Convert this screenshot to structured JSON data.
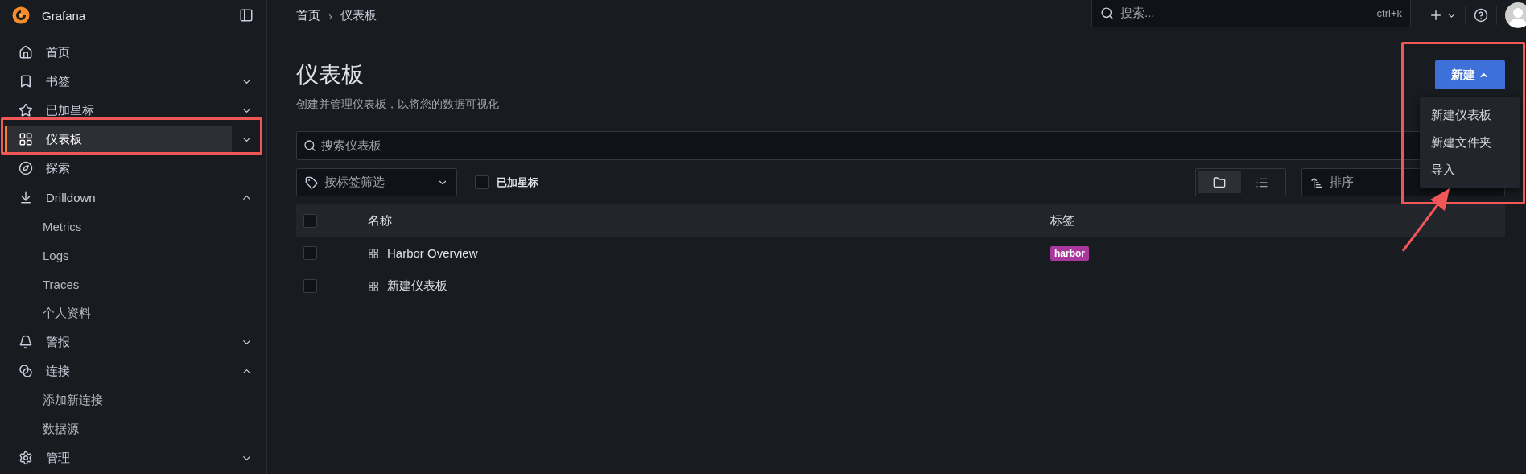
{
  "sidebar": {
    "brand": "Grafana",
    "items": [
      {
        "label": "首页",
        "kind": "link",
        "selected": false
      },
      {
        "label": "书签",
        "kind": "section",
        "selected": false,
        "expanded": false
      },
      {
        "label": "已加星标",
        "kind": "section",
        "selected": false,
        "expanded": false
      },
      {
        "label": "仪表板",
        "kind": "section",
        "selected": true,
        "expanded": false
      },
      {
        "label": "探索",
        "kind": "link",
        "selected": false
      },
      {
        "label": "Drilldown",
        "kind": "section",
        "selected": false,
        "expanded": true,
        "children": [
          {
            "label": "Metrics"
          },
          {
            "label": "Logs"
          },
          {
            "label": "Traces"
          },
          {
            "label": "个人资料"
          }
        ]
      },
      {
        "label": "警报",
        "kind": "section",
        "selected": false,
        "expanded": false
      },
      {
        "label": "连接",
        "kind": "section",
        "selected": false,
        "expanded": true,
        "children": [
          {
            "label": "添加新连接"
          },
          {
            "label": "数据源"
          }
        ]
      },
      {
        "label": "管理",
        "kind": "section",
        "selected": false,
        "expanded": false
      }
    ]
  },
  "breadcrumbs": [
    "首页",
    "仪表板"
  ],
  "breadcrumb_separator": "›",
  "top_search": {
    "placeholder": "搜索...",
    "shortcut": "ctrl+k"
  },
  "page": {
    "title": "仪表板",
    "subtitle": "创建并管理仪表板，以将您的数据可视化"
  },
  "new_button": {
    "label": "新建",
    "expanded": true,
    "menu": [
      "新建仪表板",
      "新建文件夹",
      "导入"
    ]
  },
  "search": {
    "placeholder": "搜索仪表板"
  },
  "tag_filter": {
    "placeholder": "按标签筛选"
  },
  "starred_filter": {
    "label": "已加星标",
    "checked": false
  },
  "view_toggle": [
    {
      "kind": "folder",
      "selected": true
    },
    {
      "kind": "list",
      "selected": false
    }
  ],
  "sort": {
    "placeholder": "排序"
  },
  "table": {
    "columns": [
      "名称",
      "标签"
    ],
    "header_checked": false,
    "rows": [
      {
        "name": "Harbor Overview",
        "checked": false,
        "tags": [
          {
            "label": "harbor",
            "color": "#a8389d"
          }
        ]
      },
      {
        "name": "新建仪表板",
        "checked": false
      }
    ]
  }
}
